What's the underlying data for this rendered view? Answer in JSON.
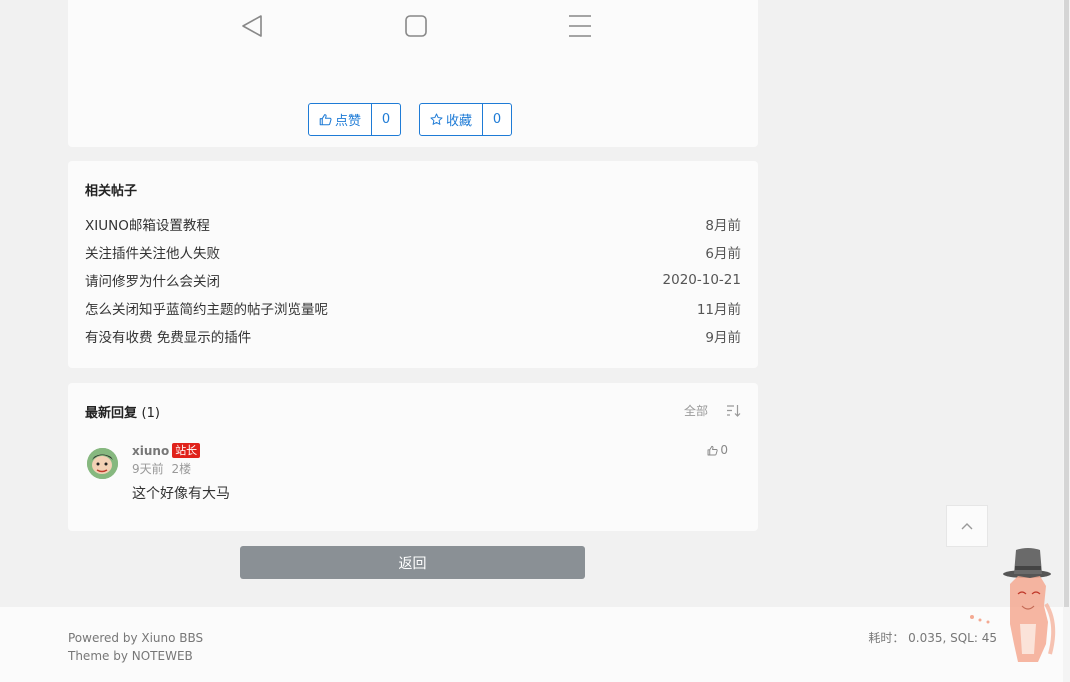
{
  "top_card": {
    "like_label": "点赞",
    "like_count": "0",
    "favorite_label": "收藏",
    "favorite_count": "0"
  },
  "related": {
    "title": "相关帖子",
    "items": [
      {
        "title": "XIUNO邮箱设置教程",
        "date": "8月前"
      },
      {
        "title": "关注插件关注他人失败",
        "date": "6月前"
      },
      {
        "title": "请问修罗为什么会关闭",
        "date": "2020-10-21"
      },
      {
        "title": "怎么关闭知乎蓝简约主题的帖子浏览量呢",
        "date": "11月前"
      },
      {
        "title": "有没有收费 免费显示的插件",
        "date": "9月前"
      }
    ]
  },
  "replies": {
    "title": "最新回复",
    "count": "(1)",
    "filter_label": "全部",
    "items": [
      {
        "username": "xiuno",
        "badge": "站长",
        "time": "9天前",
        "floor": "2楼",
        "content": "这个好像有大马",
        "likes": "0"
      }
    ]
  },
  "back_label": "返回",
  "footer": {
    "powered": "Powered by Xiuno BBS",
    "theme": "Theme by NOTEWEB",
    "stats": "耗时： 0.035, SQL: 45"
  },
  "colors": {
    "accent": "#1e7bd6",
    "badge": "#e0221b",
    "back_button": "#8a9095"
  }
}
